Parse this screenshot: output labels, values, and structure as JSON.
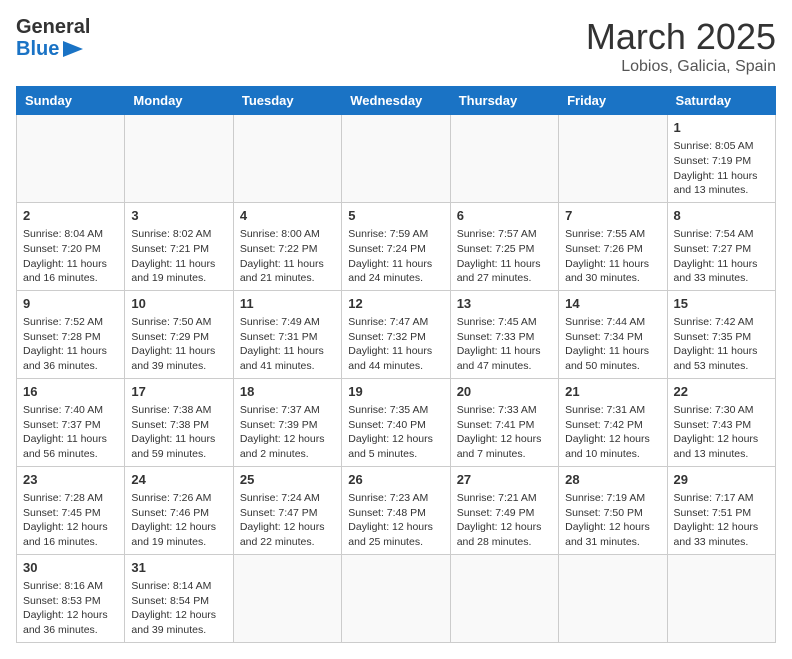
{
  "header": {
    "logo_general": "General",
    "logo_blue": "Blue",
    "month_title": "March 2025",
    "location": "Lobios, Galicia, Spain"
  },
  "weekdays": [
    "Sunday",
    "Monday",
    "Tuesday",
    "Wednesday",
    "Thursday",
    "Friday",
    "Saturday"
  ],
  "weeks": [
    [
      {
        "day": "",
        "info": ""
      },
      {
        "day": "",
        "info": ""
      },
      {
        "day": "",
        "info": ""
      },
      {
        "day": "",
        "info": ""
      },
      {
        "day": "",
        "info": ""
      },
      {
        "day": "",
        "info": ""
      },
      {
        "day": "1",
        "info": "Sunrise: 8:05 AM\nSunset: 7:19 PM\nDaylight: 11 hours and 13 minutes."
      }
    ],
    [
      {
        "day": "2",
        "info": "Sunrise: 8:04 AM\nSunset: 7:20 PM\nDaylight: 11 hours and 16 minutes."
      },
      {
        "day": "3",
        "info": "Sunrise: 8:02 AM\nSunset: 7:21 PM\nDaylight: 11 hours and 19 minutes."
      },
      {
        "day": "4",
        "info": "Sunrise: 8:00 AM\nSunset: 7:22 PM\nDaylight: 11 hours and 21 minutes."
      },
      {
        "day": "5",
        "info": "Sunrise: 7:59 AM\nSunset: 7:24 PM\nDaylight: 11 hours and 24 minutes."
      },
      {
        "day": "6",
        "info": "Sunrise: 7:57 AM\nSunset: 7:25 PM\nDaylight: 11 hours and 27 minutes."
      },
      {
        "day": "7",
        "info": "Sunrise: 7:55 AM\nSunset: 7:26 PM\nDaylight: 11 hours and 30 minutes."
      },
      {
        "day": "8",
        "info": "Sunrise: 7:54 AM\nSunset: 7:27 PM\nDaylight: 11 hours and 33 minutes."
      }
    ],
    [
      {
        "day": "9",
        "info": "Sunrise: 7:52 AM\nSunset: 7:28 PM\nDaylight: 11 hours and 36 minutes."
      },
      {
        "day": "10",
        "info": "Sunrise: 7:50 AM\nSunset: 7:29 PM\nDaylight: 11 hours and 39 minutes."
      },
      {
        "day": "11",
        "info": "Sunrise: 7:49 AM\nSunset: 7:31 PM\nDaylight: 11 hours and 41 minutes."
      },
      {
        "day": "12",
        "info": "Sunrise: 7:47 AM\nSunset: 7:32 PM\nDaylight: 11 hours and 44 minutes."
      },
      {
        "day": "13",
        "info": "Sunrise: 7:45 AM\nSunset: 7:33 PM\nDaylight: 11 hours and 47 minutes."
      },
      {
        "day": "14",
        "info": "Sunrise: 7:44 AM\nSunset: 7:34 PM\nDaylight: 11 hours and 50 minutes."
      },
      {
        "day": "15",
        "info": "Sunrise: 7:42 AM\nSunset: 7:35 PM\nDaylight: 11 hours and 53 minutes."
      }
    ],
    [
      {
        "day": "16",
        "info": "Sunrise: 7:40 AM\nSunset: 7:37 PM\nDaylight: 11 hours and 56 minutes."
      },
      {
        "day": "17",
        "info": "Sunrise: 7:38 AM\nSunset: 7:38 PM\nDaylight: 11 hours and 59 minutes."
      },
      {
        "day": "18",
        "info": "Sunrise: 7:37 AM\nSunset: 7:39 PM\nDaylight: 12 hours and 2 minutes."
      },
      {
        "day": "19",
        "info": "Sunrise: 7:35 AM\nSunset: 7:40 PM\nDaylight: 12 hours and 5 minutes."
      },
      {
        "day": "20",
        "info": "Sunrise: 7:33 AM\nSunset: 7:41 PM\nDaylight: 12 hours and 7 minutes."
      },
      {
        "day": "21",
        "info": "Sunrise: 7:31 AM\nSunset: 7:42 PM\nDaylight: 12 hours and 10 minutes."
      },
      {
        "day": "22",
        "info": "Sunrise: 7:30 AM\nSunset: 7:43 PM\nDaylight: 12 hours and 13 minutes."
      }
    ],
    [
      {
        "day": "23",
        "info": "Sunrise: 7:28 AM\nSunset: 7:45 PM\nDaylight: 12 hours and 16 minutes."
      },
      {
        "day": "24",
        "info": "Sunrise: 7:26 AM\nSunset: 7:46 PM\nDaylight: 12 hours and 19 minutes."
      },
      {
        "day": "25",
        "info": "Sunrise: 7:24 AM\nSunset: 7:47 PM\nDaylight: 12 hours and 22 minutes."
      },
      {
        "day": "26",
        "info": "Sunrise: 7:23 AM\nSunset: 7:48 PM\nDaylight: 12 hours and 25 minutes."
      },
      {
        "day": "27",
        "info": "Sunrise: 7:21 AM\nSunset: 7:49 PM\nDaylight: 12 hours and 28 minutes."
      },
      {
        "day": "28",
        "info": "Sunrise: 7:19 AM\nSunset: 7:50 PM\nDaylight: 12 hours and 31 minutes."
      },
      {
        "day": "29",
        "info": "Sunrise: 7:17 AM\nSunset: 7:51 PM\nDaylight: 12 hours and 33 minutes."
      }
    ],
    [
      {
        "day": "30",
        "info": "Sunrise: 8:16 AM\nSunset: 8:53 PM\nDaylight: 12 hours and 36 minutes."
      },
      {
        "day": "31",
        "info": "Sunrise: 8:14 AM\nSunset: 8:54 PM\nDaylight: 12 hours and 39 minutes."
      },
      {
        "day": "",
        "info": ""
      },
      {
        "day": "",
        "info": ""
      },
      {
        "day": "",
        "info": ""
      },
      {
        "day": "",
        "info": ""
      },
      {
        "day": "",
        "info": ""
      }
    ]
  ]
}
